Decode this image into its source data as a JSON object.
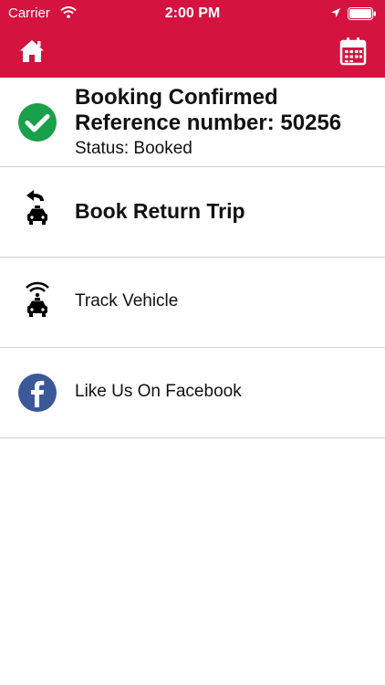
{
  "status_bar": {
    "carrier": "Carrier",
    "time": "2:00 PM"
  },
  "colors": {
    "brand": "#d5133f",
    "success": "#1aa04a",
    "facebook": "#3b5998"
  },
  "header": {
    "home_icon": "home-icon",
    "calendar_icon": "calendar-icon"
  },
  "booking": {
    "title": "Booking Confirmed",
    "reference": "Reference number: 50256",
    "status": "Status: Booked",
    "icon": "check-circle-icon"
  },
  "actions": [
    {
      "label": "Book Return Trip",
      "icon": "return-taxi-icon"
    },
    {
      "label": "Track Vehicle",
      "icon": "track-taxi-icon"
    },
    {
      "label": "Like Us On Facebook",
      "icon": "facebook-icon"
    }
  ]
}
